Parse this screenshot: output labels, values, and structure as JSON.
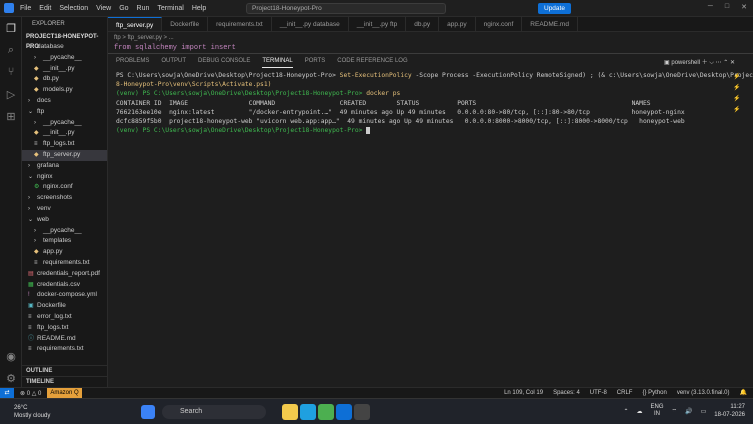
{
  "titlebar": {
    "menu": [
      "File",
      "Edit",
      "Selection",
      "View",
      "Go",
      "Run",
      "Terminal",
      "Help"
    ],
    "command_center": "Project18-Honeypot-Pro",
    "update_label": "Update"
  },
  "sidebar": {
    "header": "EXPLORER",
    "project": "PROJECT18-HONEYPOT-PRO",
    "items": [
      {
        "label": "database",
        "indent": 1,
        "icon": "chevron-down",
        "color": "#ccc"
      },
      {
        "label": "__pycache__",
        "indent": 2,
        "icon": "chevron-right",
        "color": "#ccc"
      },
      {
        "label": "__init__.py",
        "indent": 2,
        "icon": "py",
        "color": "#e5c07b"
      },
      {
        "label": "db.py",
        "indent": 2,
        "icon": "py",
        "color": "#e5c07b"
      },
      {
        "label": "models.py",
        "indent": 2,
        "icon": "py",
        "color": "#e5c07b"
      },
      {
        "label": "docs",
        "indent": 1,
        "icon": "chevron-right",
        "color": "#ccc"
      },
      {
        "label": "ftp",
        "indent": 1,
        "icon": "chevron-down",
        "color": "#ccc"
      },
      {
        "label": "__pycache__",
        "indent": 2,
        "icon": "chevron-right",
        "color": "#ccc"
      },
      {
        "label": "__init__.py",
        "indent": 2,
        "icon": "py",
        "color": "#e5c07b"
      },
      {
        "label": "ftp_logs.txt",
        "indent": 2,
        "icon": "txt",
        "color": "#ccc"
      },
      {
        "label": "ftp_server.py",
        "indent": 2,
        "icon": "py",
        "color": "#e5c07b",
        "selected": true
      },
      {
        "label": "grafana",
        "indent": 1,
        "icon": "chevron-right",
        "color": "#ccc"
      },
      {
        "label": "nginx",
        "indent": 1,
        "icon": "chevron-down",
        "color": "#ccc"
      },
      {
        "label": "nginx.conf",
        "indent": 2,
        "icon": "gear",
        "color": "#3fb950"
      },
      {
        "label": "screenshots",
        "indent": 1,
        "icon": "chevron-right",
        "color": "#ccc"
      },
      {
        "label": "venv",
        "indent": 1,
        "icon": "chevron-right",
        "color": "#ccc"
      },
      {
        "label": "web",
        "indent": 1,
        "icon": "chevron-down",
        "color": "#ccc"
      },
      {
        "label": "__pycache__",
        "indent": 2,
        "icon": "chevron-right",
        "color": "#ccc"
      },
      {
        "label": "templates",
        "indent": 2,
        "icon": "chevron-right",
        "color": "#ccc"
      },
      {
        "label": "app.py",
        "indent": 2,
        "icon": "py",
        "color": "#e5c07b"
      },
      {
        "label": "requirements.txt",
        "indent": 2,
        "icon": "txt",
        "color": "#ccc"
      },
      {
        "label": "credentials_report.pdf",
        "indent": 1,
        "icon": "pdf",
        "color": "#e06c75"
      },
      {
        "label": "credentials.csv",
        "indent": 1,
        "icon": "csv",
        "color": "#3fb950"
      },
      {
        "label": "docker-compose.yml",
        "indent": 1,
        "icon": "yml",
        "color": "#c586c0"
      },
      {
        "label": "Dockerfile",
        "indent": 1,
        "icon": "docker",
        "color": "#56b6c2"
      },
      {
        "label": "error_log.txt",
        "indent": 1,
        "icon": "txt",
        "color": "#ccc"
      },
      {
        "label": "ftp_logs.txt",
        "indent": 1,
        "icon": "txt",
        "color": "#ccc"
      },
      {
        "label": "README.md",
        "indent": 1,
        "icon": "info",
        "color": "#56b6c2"
      },
      {
        "label": "requirements.txt",
        "indent": 1,
        "icon": "txt",
        "color": "#ccc"
      }
    ],
    "outline": "OUTLINE",
    "timeline": "TIMELINE"
  },
  "tabs": [
    {
      "label": "ftp_server.py",
      "active": true
    },
    {
      "label": "Dockerfile"
    },
    {
      "label": "requirements.txt"
    },
    {
      "label": "__init__.py database"
    },
    {
      "label": "__init__.py ftp"
    },
    {
      "label": "db.py"
    },
    {
      "label": "app.py"
    },
    {
      "label": "nginx.conf"
    },
    {
      "label": "README.md"
    }
  ],
  "editor": {
    "breadcrumb": "ftp > ftp_server.py > ...",
    "code_line": "from sqlalchemy import insert"
  },
  "panel": {
    "tabs": [
      "PROBLEMS",
      "OUTPUT",
      "DEBUG CONSOLE",
      "TERMINAL",
      "PORTS",
      "CODE REFERENCE LOG"
    ],
    "active_tab": "TERMINAL",
    "shell": "powershell"
  },
  "terminal": {
    "line1": "PS C:\\Users\\sowja\\OneDrive\\Desktop\\Project18-Honeypot-Pro> ",
    "line1_cmd": "Set-ExecutionPolicy",
    "line1_rest": " -Scope Process -ExecutionPolicy RemoteSigned) ; (& c:\\Users\\sowja\\OneDrive\\Desktop\\Project1",
    "line2": "8-Honeypot-Pro\\venv\\Scripts\\Activate.ps1)",
    "line3_prompt": "(venv) PS C:\\Users\\sowja\\OneDrive\\Desktop\\Project18-Honeypot-Pro> ",
    "line3_cmd": "docker ps",
    "headers": [
      "CONTAINER ID",
      "IMAGE",
      "COMMAND",
      "CREATED",
      "STATUS",
      "PORTS",
      "NAMES"
    ],
    "rows": [
      [
        "7662163ee10e",
        "nginx:latest",
        "\"/docker-entrypoint.…\"",
        "49 minutes ago",
        "Up 49 minutes",
        "0.0.0.0:80->80/tcp, [::]:80->80/tcp",
        "honeypot-nginx"
      ],
      [
        "dcfc8859f5b0",
        "project18-honeypot-web",
        "\"uvicorn web.app:app…\"",
        "49 minutes ago",
        "Up 49 minutes",
        "0.0.0.0:8000->8000/tcp, [::]:8000->8000/tcp",
        "honeypot-web"
      ]
    ],
    "last_prompt": "(venv) PS C:\\Users\\sowja\\OneDrive\\Desktop\\Project18-Honeypot-Pro> "
  },
  "statusbar": {
    "errors": "0",
    "warnings": "0",
    "amazon": "Amazon Q",
    "position": "Ln 109, Col 19",
    "spaces": "Spaces: 4",
    "encoding": "UTF-8",
    "eol": "CRLF",
    "language": "{} Python",
    "venv": "venv (3.13.0.final.0)"
  },
  "taskbar": {
    "temp": "26°C",
    "weather": "Mostly cloudy",
    "search": "Search",
    "lang1": "ENG",
    "lang2": "IN",
    "time": "11:27",
    "date": "18-07-2026"
  }
}
